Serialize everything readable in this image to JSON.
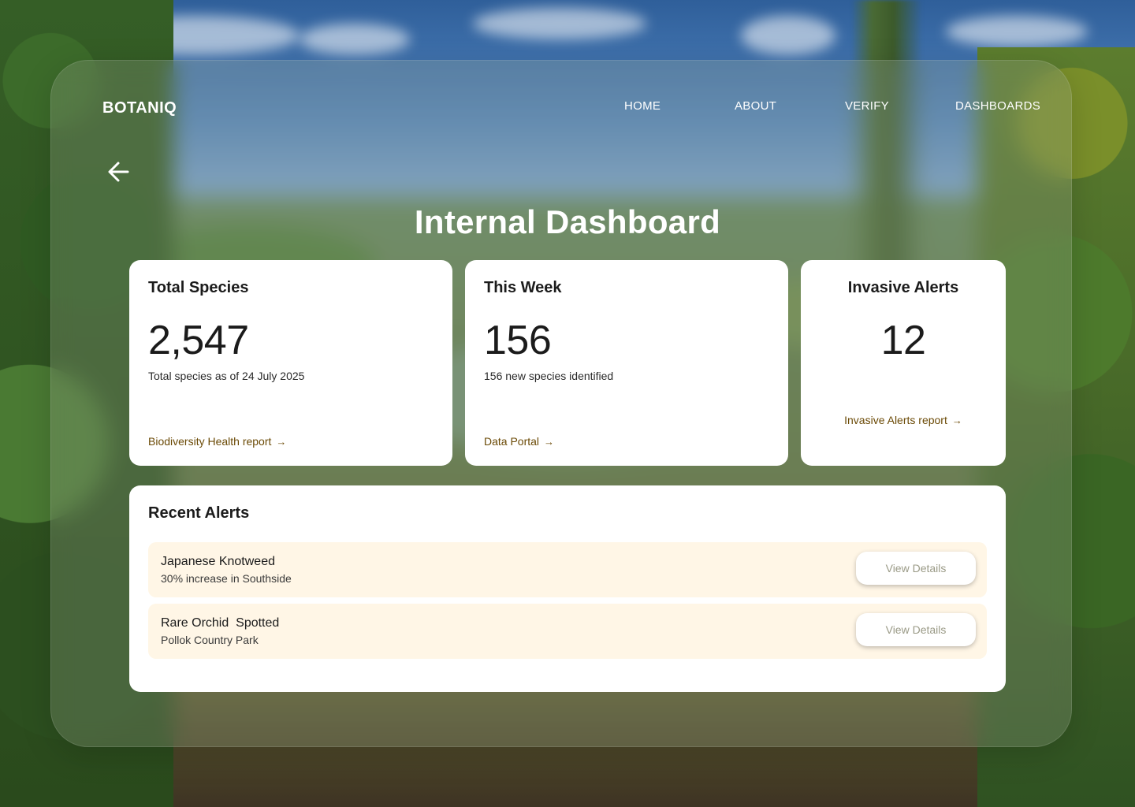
{
  "brand": "BOTANIQ",
  "nav": {
    "home": "HOME",
    "about": "ABOUT",
    "verify": "VERIFY",
    "dashboards": "DASHBOARDS"
  },
  "page_title": "Internal Dashboard",
  "cards": {
    "total_species": {
      "title": "Total Species",
      "value": "2,547",
      "subtitle": "Total species as of 24 July 2025",
      "link": "Biodiversity Health report"
    },
    "this_week": {
      "title": "This Week",
      "value": "156",
      "subtitle": "156 new species identified",
      "link": "Data Portal"
    },
    "invasive_alerts": {
      "title": "Invasive Alerts",
      "value": "12",
      "link": "Invasive Alerts report"
    }
  },
  "recent_alerts": {
    "heading": "Recent Alerts",
    "items": [
      {
        "name": "Japanese Knotweed",
        "detail": "30% increase in Southside",
        "button": "View Details"
      },
      {
        "name": "Rare Orchid  Spotted",
        "detail": "Pollok Country Park",
        "button": "View Details"
      }
    ]
  },
  "icons": {
    "back": "arrow-left-icon",
    "link_arrow": "arrow-right-icon"
  },
  "colors": {
    "link": "#6b4a06",
    "alert_row_bg": "#fff6e6",
    "button_text": "#9a9a86"
  }
}
